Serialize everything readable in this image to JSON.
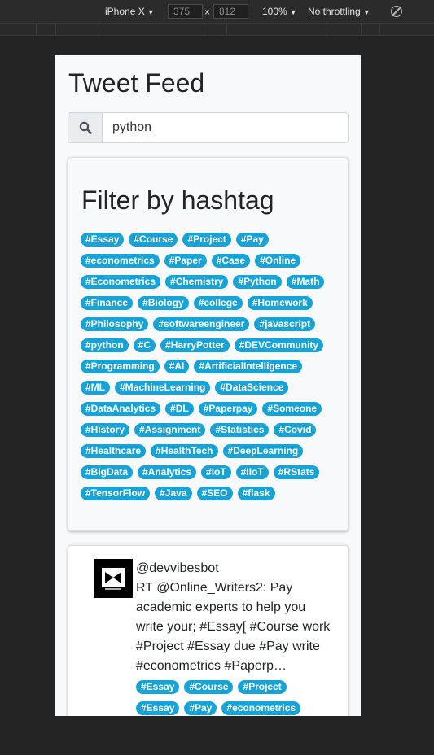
{
  "devtools": {
    "device": "iPhone X",
    "width": "375",
    "times": "×",
    "height": "812",
    "zoom": "100%",
    "throttling": "No throttling",
    "caret": "▼"
  },
  "page": {
    "title": "Tweet Feed"
  },
  "search": {
    "value": "python",
    "icon": "search-icon"
  },
  "filter": {
    "title": "Filter by hashtag",
    "tags": [
      "#Essay",
      "#Course",
      "#Project",
      "#Pay",
      "#econometrics",
      "#Paper",
      "#Case",
      "#Online",
      "#Econometrics",
      "#Chemistry",
      "#Python",
      "#Math",
      "#Finance",
      "#Biology",
      "#college",
      "#Homework",
      "#Philosophy",
      "#softwareengineer",
      "#javascript",
      "#python",
      "#C",
      "#HarryPotter",
      "#DEVCommunity",
      "#Programming",
      "#AI",
      "#ArtificialIntelligence",
      "#ML",
      "#MachineLearning",
      "#DataScience",
      "#DataAnalytics",
      "#DL",
      "#Paperpay",
      "#Someone",
      "#History",
      "#Assignment",
      "#Statistics",
      "#Covid",
      "#Healthcare",
      "#HealthTech",
      "#DeepLearning",
      "#BigData",
      "#Analytics",
      "#IoT",
      "#IIoT",
      "#RStats",
      "#TensorFlow",
      "#Java",
      "#SEO",
      "#flask"
    ]
  },
  "tweet": {
    "handle": "@devvibesbot",
    "text": "RT @Online_Writers2: Pay academic experts to help you write your; #Essay[ #Course work #Project #Essay due #Pay write #econometrics #Paperp…",
    "tags": [
      "#Essay",
      "#Course",
      "#Project",
      "#Essay",
      "#Pay",
      "#econometrics"
    ]
  },
  "colors": {
    "tag": "#17a2d8",
    "page_bg": "#f8f9fa",
    "devtools_bg": "#242424"
  }
}
